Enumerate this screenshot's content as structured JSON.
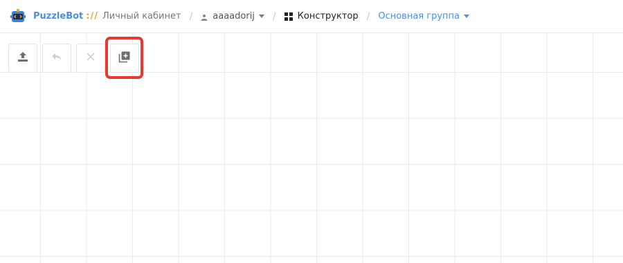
{
  "header": {
    "brand": "PuzzleBot",
    "brand_sep": "://",
    "cabinet": "Личный кабинет",
    "account": "aaaadorij",
    "builder": "Конструктор",
    "group": "Основная группа"
  },
  "toolbar": {
    "buttons": [
      {
        "icon": "upload-icon",
        "state": "enabled"
      },
      {
        "icon": "undo-icon",
        "state": "disabled"
      },
      {
        "icon": "close-icon",
        "state": "disabled"
      },
      {
        "icon": "add-block-icon",
        "state": "enabled",
        "highlighted": true
      }
    ]
  },
  "colors": {
    "brand": "#4a90e2",
    "brand_sep": "#f5a623",
    "highlight": "#e8392e",
    "grid_line": "#ebebeb"
  }
}
